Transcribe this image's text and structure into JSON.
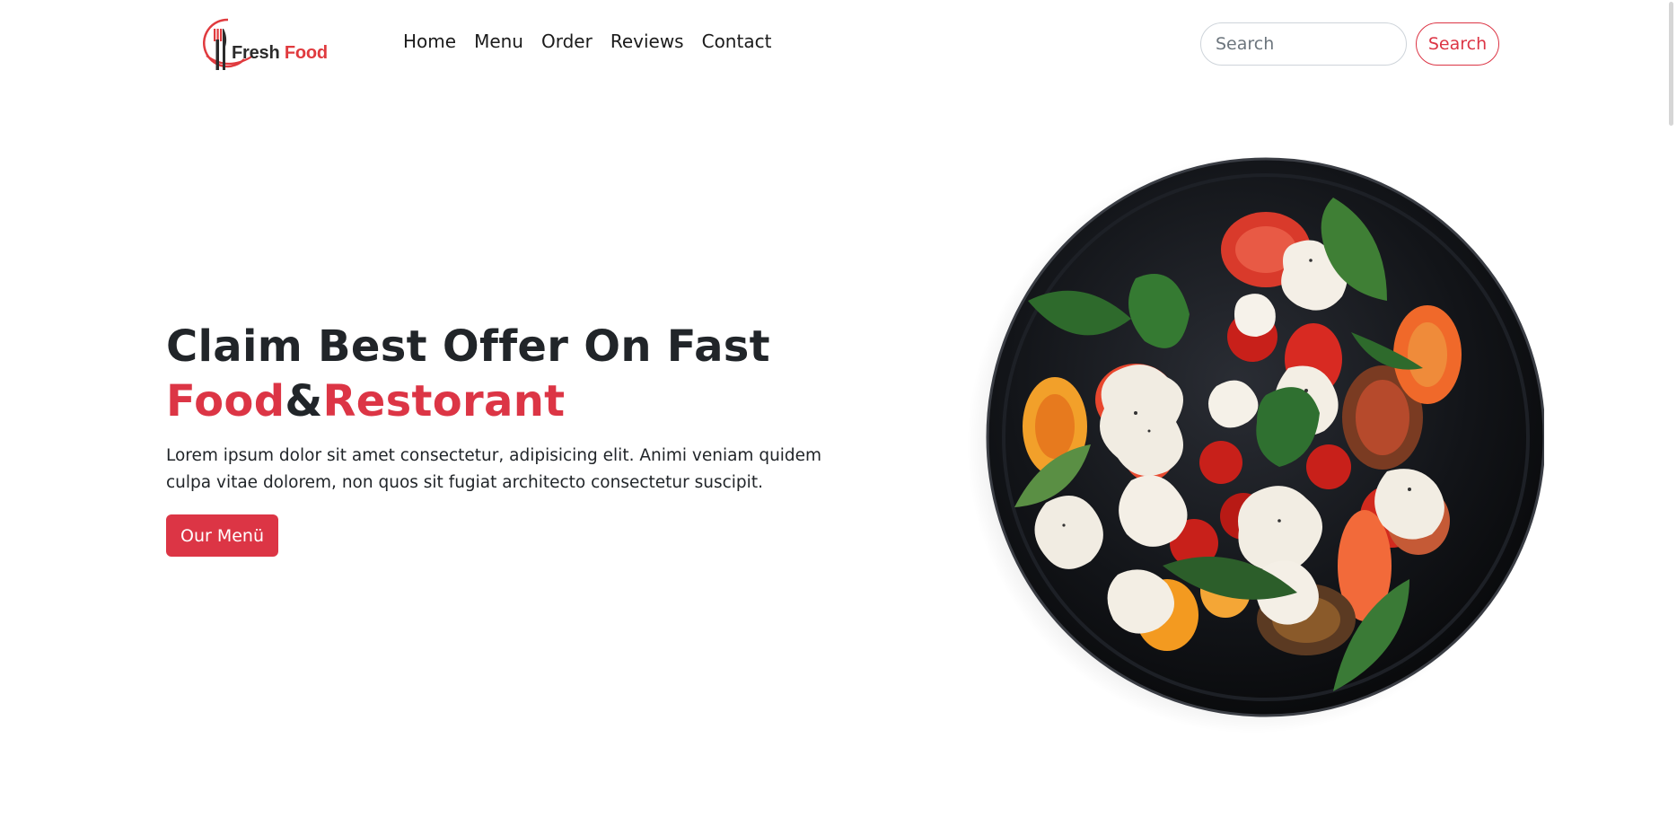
{
  "brand": {
    "word1": "Fresh",
    "word2": "Food",
    "icon": "fork-knife-logo-icon",
    "accent_color": "#e03a3e"
  },
  "nav": {
    "links": [
      "Home",
      "Menu",
      "Order",
      "Reviews",
      "Contact"
    ]
  },
  "search": {
    "placeholder": "Search",
    "button_label": "Search",
    "button_color": "#dc3545"
  },
  "hero": {
    "title_line1": "Claim Best Offer On Fast",
    "title_word_a": "Food",
    "title_amp": "&",
    "title_word_b": "Restorant",
    "description": "Lorem ipsum dolor sit amet consectetur, adipisicing elit. Animi veniam quidem culpa vitae dolorem, non quos sit fugiat architecto consectetur suscipit.",
    "cta_label": "Our Menü",
    "accent_color": "#dc3545",
    "image": "salad-plate-image"
  }
}
